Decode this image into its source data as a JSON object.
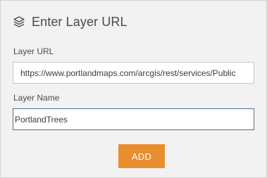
{
  "header": {
    "icon": "layers-icon",
    "title": "Enter Layer URL"
  },
  "form": {
    "url_label": "Layer URL",
    "url_value": "https://www.portlandmaps.com/arcgis/rest/services/Public",
    "name_label": "Layer Name",
    "name_value": "PortlandTrees"
  },
  "actions": {
    "add_label": "ADD"
  },
  "colors": {
    "accent": "#e98e2e",
    "panel_background": "#f2f2f2",
    "focus_border": "#5a6d82"
  }
}
